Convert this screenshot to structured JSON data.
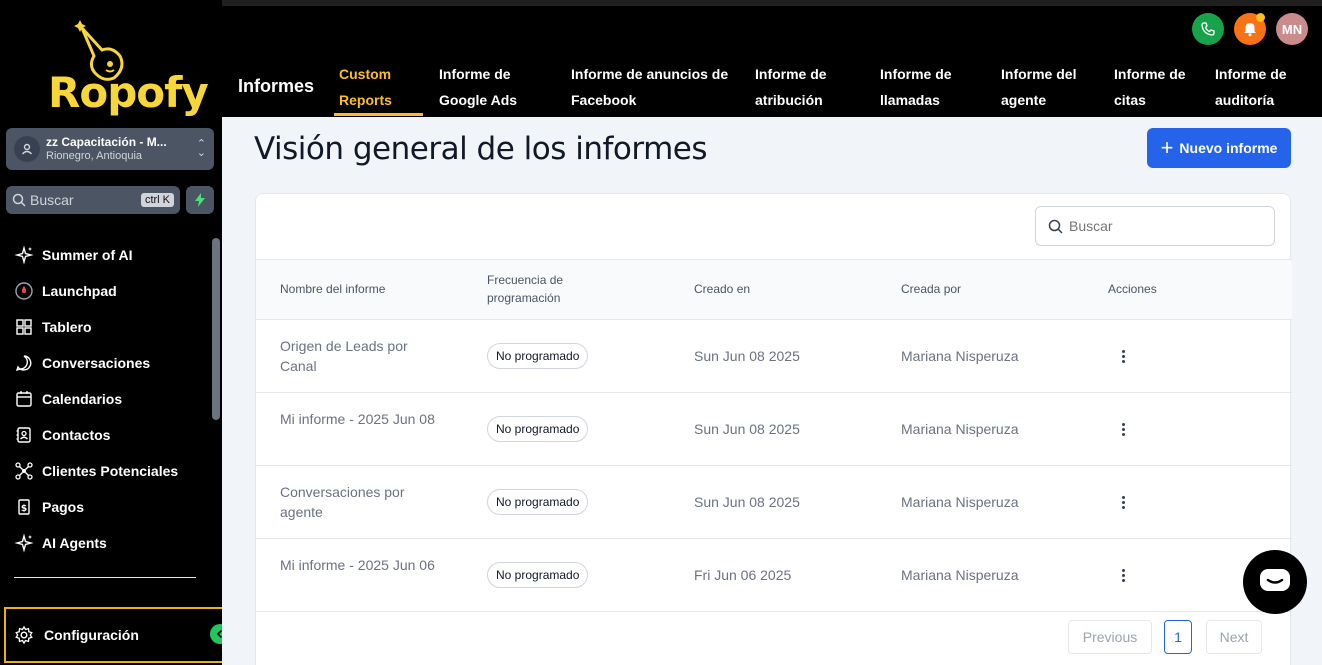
{
  "brand": {
    "name": "Ropofy"
  },
  "location": {
    "name": "zz Capacitación - M...",
    "city": "Rionegro, Antioquia"
  },
  "sidebar_search": {
    "placeholder": "Buscar",
    "shortcut": "ctrl K"
  },
  "nav": [
    {
      "label": "Summer of AI",
      "icon": "sparkle-icon"
    },
    {
      "label": "Launchpad",
      "icon": "rocket-icon"
    },
    {
      "label": "Tablero",
      "icon": "dashboard-icon"
    },
    {
      "label": "Conversaciones",
      "icon": "chat-bubble-icon"
    },
    {
      "label": "Calendarios",
      "icon": "calendar-icon"
    },
    {
      "label": "Contactos",
      "icon": "contacts-icon"
    },
    {
      "label": "Clientes Potenciales",
      "icon": "pipeline-icon"
    },
    {
      "label": "Pagos",
      "icon": "payments-icon"
    },
    {
      "label": "AI Agents",
      "icon": "sparkle-icon"
    }
  ],
  "settings": {
    "label": "Configuración"
  },
  "header": {
    "section": "Informes",
    "tabs": [
      {
        "l1": "Custom",
        "l2": "Reports"
      },
      {
        "l1": "Informe de",
        "l2": "Google Ads"
      },
      {
        "l1": "Informe de anuncios de",
        "l2": "Facebook"
      },
      {
        "l1": "Informe de",
        "l2": "atribución"
      },
      {
        "l1": "Informe de",
        "l2": "llamadas"
      },
      {
        "l1": "Informe del",
        "l2": "agente"
      },
      {
        "l1": "Informe de",
        "l2": "citas"
      },
      {
        "l1": "Informe de",
        "l2": "auditoría"
      }
    ],
    "user_initials": "MN"
  },
  "page": {
    "title": "Visión general de los informes",
    "new_button": "Nuevo informe"
  },
  "table_search": {
    "placeholder": "Buscar"
  },
  "table": {
    "columns": [
      "Nombre del informe",
      "Frecuencia de programación",
      "Creado en",
      "Creada por",
      "Acciones"
    ],
    "rows": [
      {
        "name": "Origen de Leads por Canal",
        "frequency": "No programado",
        "created": "Sun Jun 08 2025",
        "author": "Mariana Nisperuza"
      },
      {
        "name": "Mi informe - 2025 Jun 08",
        "frequency": "No programado",
        "created": "Sun Jun 08 2025",
        "author": "Mariana Nisperuza"
      },
      {
        "name": "Conversaciones por agente",
        "frequency": "No programado",
        "created": "Sun Jun 08 2025",
        "author": "Mariana Nisperuza"
      },
      {
        "name": "Mi informe - 2025 Jun 06",
        "frequency": "No programado",
        "created": "Fri Jun 06 2025",
        "author": "Mariana Nisperuza"
      }
    ]
  },
  "pagination": {
    "previous": "Previous",
    "page": "1",
    "next": "Next"
  },
  "colors": {
    "accent": "#fbbf24",
    "primary": "#2563eb",
    "highlight": "#eab308"
  }
}
